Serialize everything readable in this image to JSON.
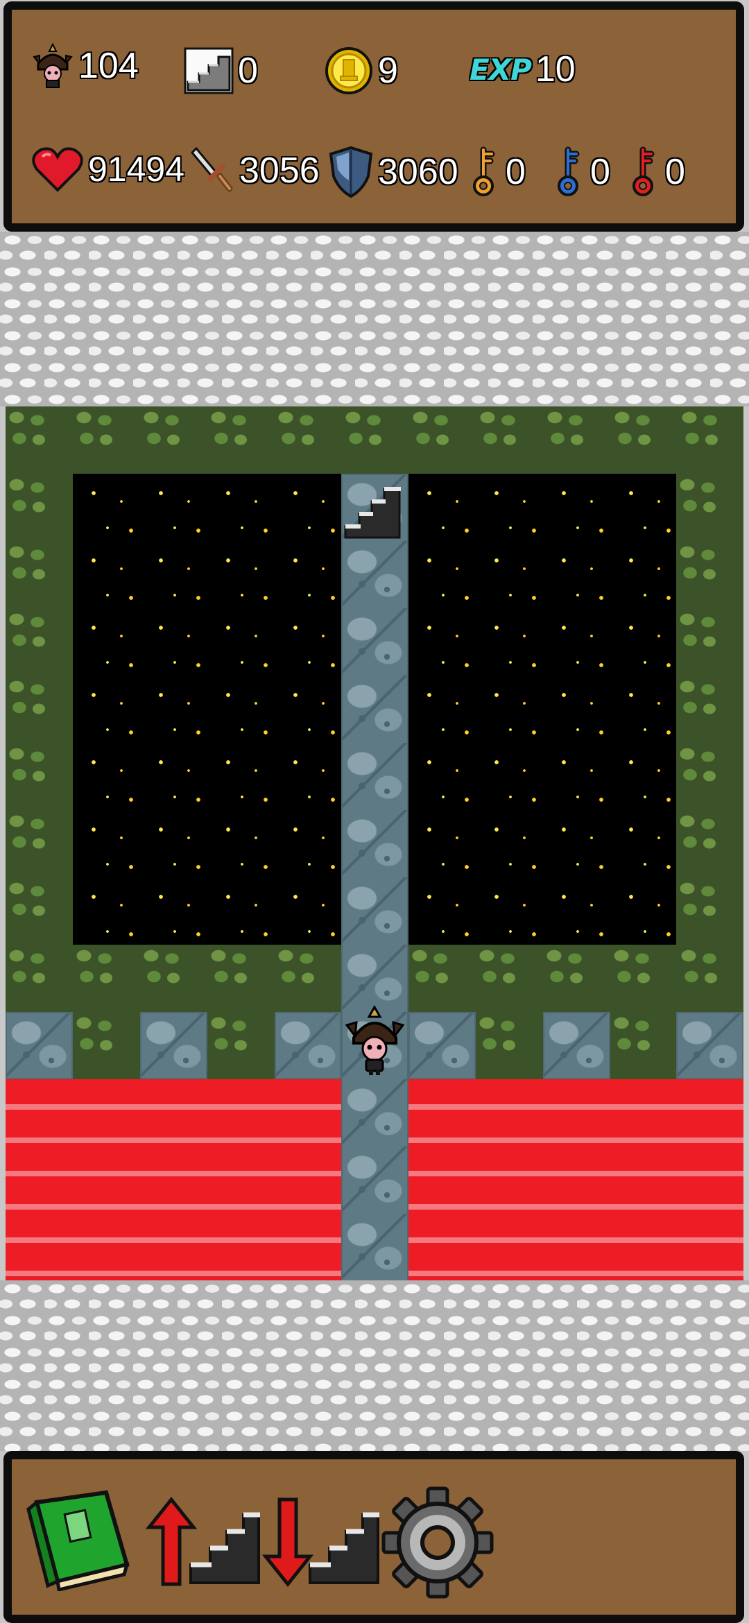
{
  "stats": {
    "floor": "104",
    "stairs": "0",
    "gold": "9",
    "exp_label": "EXP",
    "exp": "10",
    "hp": "91494",
    "attack": "3056",
    "defense": "3060",
    "yellow_keys": "0",
    "blue_keys": "0",
    "red_keys": "0"
  },
  "icons": {
    "floor": "hero-portrait-icon",
    "stairs": "stairs-icon",
    "gold": "gold-coin-icon",
    "exp": "exp-icon",
    "hp": "heart-icon",
    "attack": "sword-icon",
    "defense": "shield-icon",
    "yellow_key": "yellow-key-icon",
    "blue_key": "blue-key-icon",
    "red_key": "red-key-icon"
  },
  "toolbar": {
    "buttons": [
      "monster-book-button",
      "floor-up-button",
      "floor-down-button",
      "settings-button"
    ]
  },
  "colors": {
    "panel": "#8c6239",
    "panel_border": "#0d0d0d",
    "lava": "#ee1c25",
    "moss": "#5f8a3b",
    "stone": "#6f8c97",
    "star": "#ffe84a",
    "exp_text": "#3fd6d9",
    "yellow_key": "#f0a030",
    "blue_key": "#2a6fd6",
    "red_key": "#e02020"
  }
}
